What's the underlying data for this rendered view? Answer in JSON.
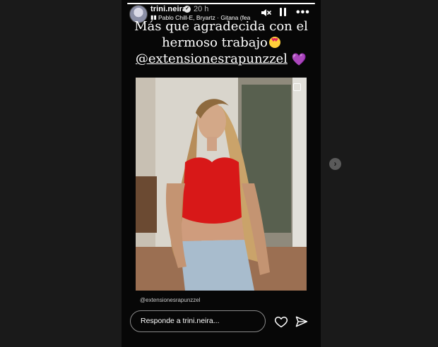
{
  "story": {
    "progress_fraction": 1.0,
    "header": {
      "username": "trini.neira",
      "verified_mark": "✓",
      "time_ago": "20 h",
      "music_icon": "music-bars-icon",
      "music_text": "Pablo Chill-E, Bryartz · Gitana (fea"
    },
    "controls": {
      "mute_icon": "speaker-muted-icon",
      "pause_icon": "pause-icon",
      "more_icon": "more-dots-icon",
      "more_glyph": "•••"
    },
    "caption": {
      "line1": "Más que agradecida con el",
      "line2": "hermoso trabajo",
      "line3_mention": "@extensionesrapunzzel",
      "heart_glyph": "💜"
    },
    "photo_credit": "@extensionesrapunzzel",
    "reply": {
      "placeholder": "Responde a trini.neira..."
    }
  },
  "navigation": {
    "next_glyph": "›"
  },
  "colors": {
    "background": "#1a1a1a",
    "story_bg": "#070707",
    "top_red": "#d81818",
    "caption_text": "#ffffff",
    "purple_heart": "#9b59e6"
  }
}
